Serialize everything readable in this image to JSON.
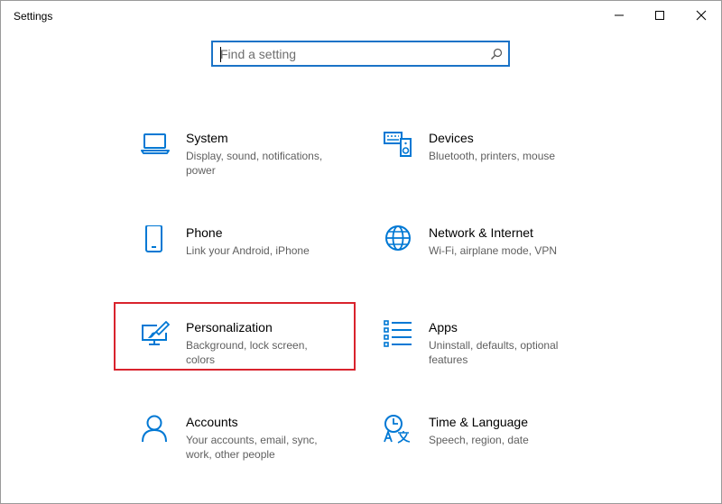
{
  "window": {
    "title": "Settings"
  },
  "search": {
    "placeholder": "Find a setting",
    "value": ""
  },
  "colors": {
    "accent": "#0078d4",
    "highlight": "#d9232d",
    "desc": "#5f5f5f"
  },
  "categories": [
    {
      "name": "System",
      "desc": "Display, sound, notifications, power",
      "icon": "laptop-icon"
    },
    {
      "name": "Devices",
      "desc": "Bluetooth, printers, mouse",
      "icon": "keyboard-speaker-icon"
    },
    {
      "name": "Phone",
      "desc": "Link your Android, iPhone",
      "icon": "phone-icon"
    },
    {
      "name": "Network & Internet",
      "desc": "Wi-Fi, airplane mode, VPN",
      "icon": "globe-icon"
    },
    {
      "name": "Personalization",
      "desc": "Background, lock screen, colors",
      "icon": "paintbrush-monitor-icon",
      "highlighted": true
    },
    {
      "name": "Apps",
      "desc": "Uninstall, defaults, optional features",
      "icon": "app-list-icon"
    },
    {
      "name": "Accounts",
      "desc": "Your accounts, email, sync, work, other people",
      "icon": "person-icon"
    },
    {
      "name": "Time & Language",
      "desc": "Speech, region, date",
      "icon": "time-language-icon"
    }
  ]
}
